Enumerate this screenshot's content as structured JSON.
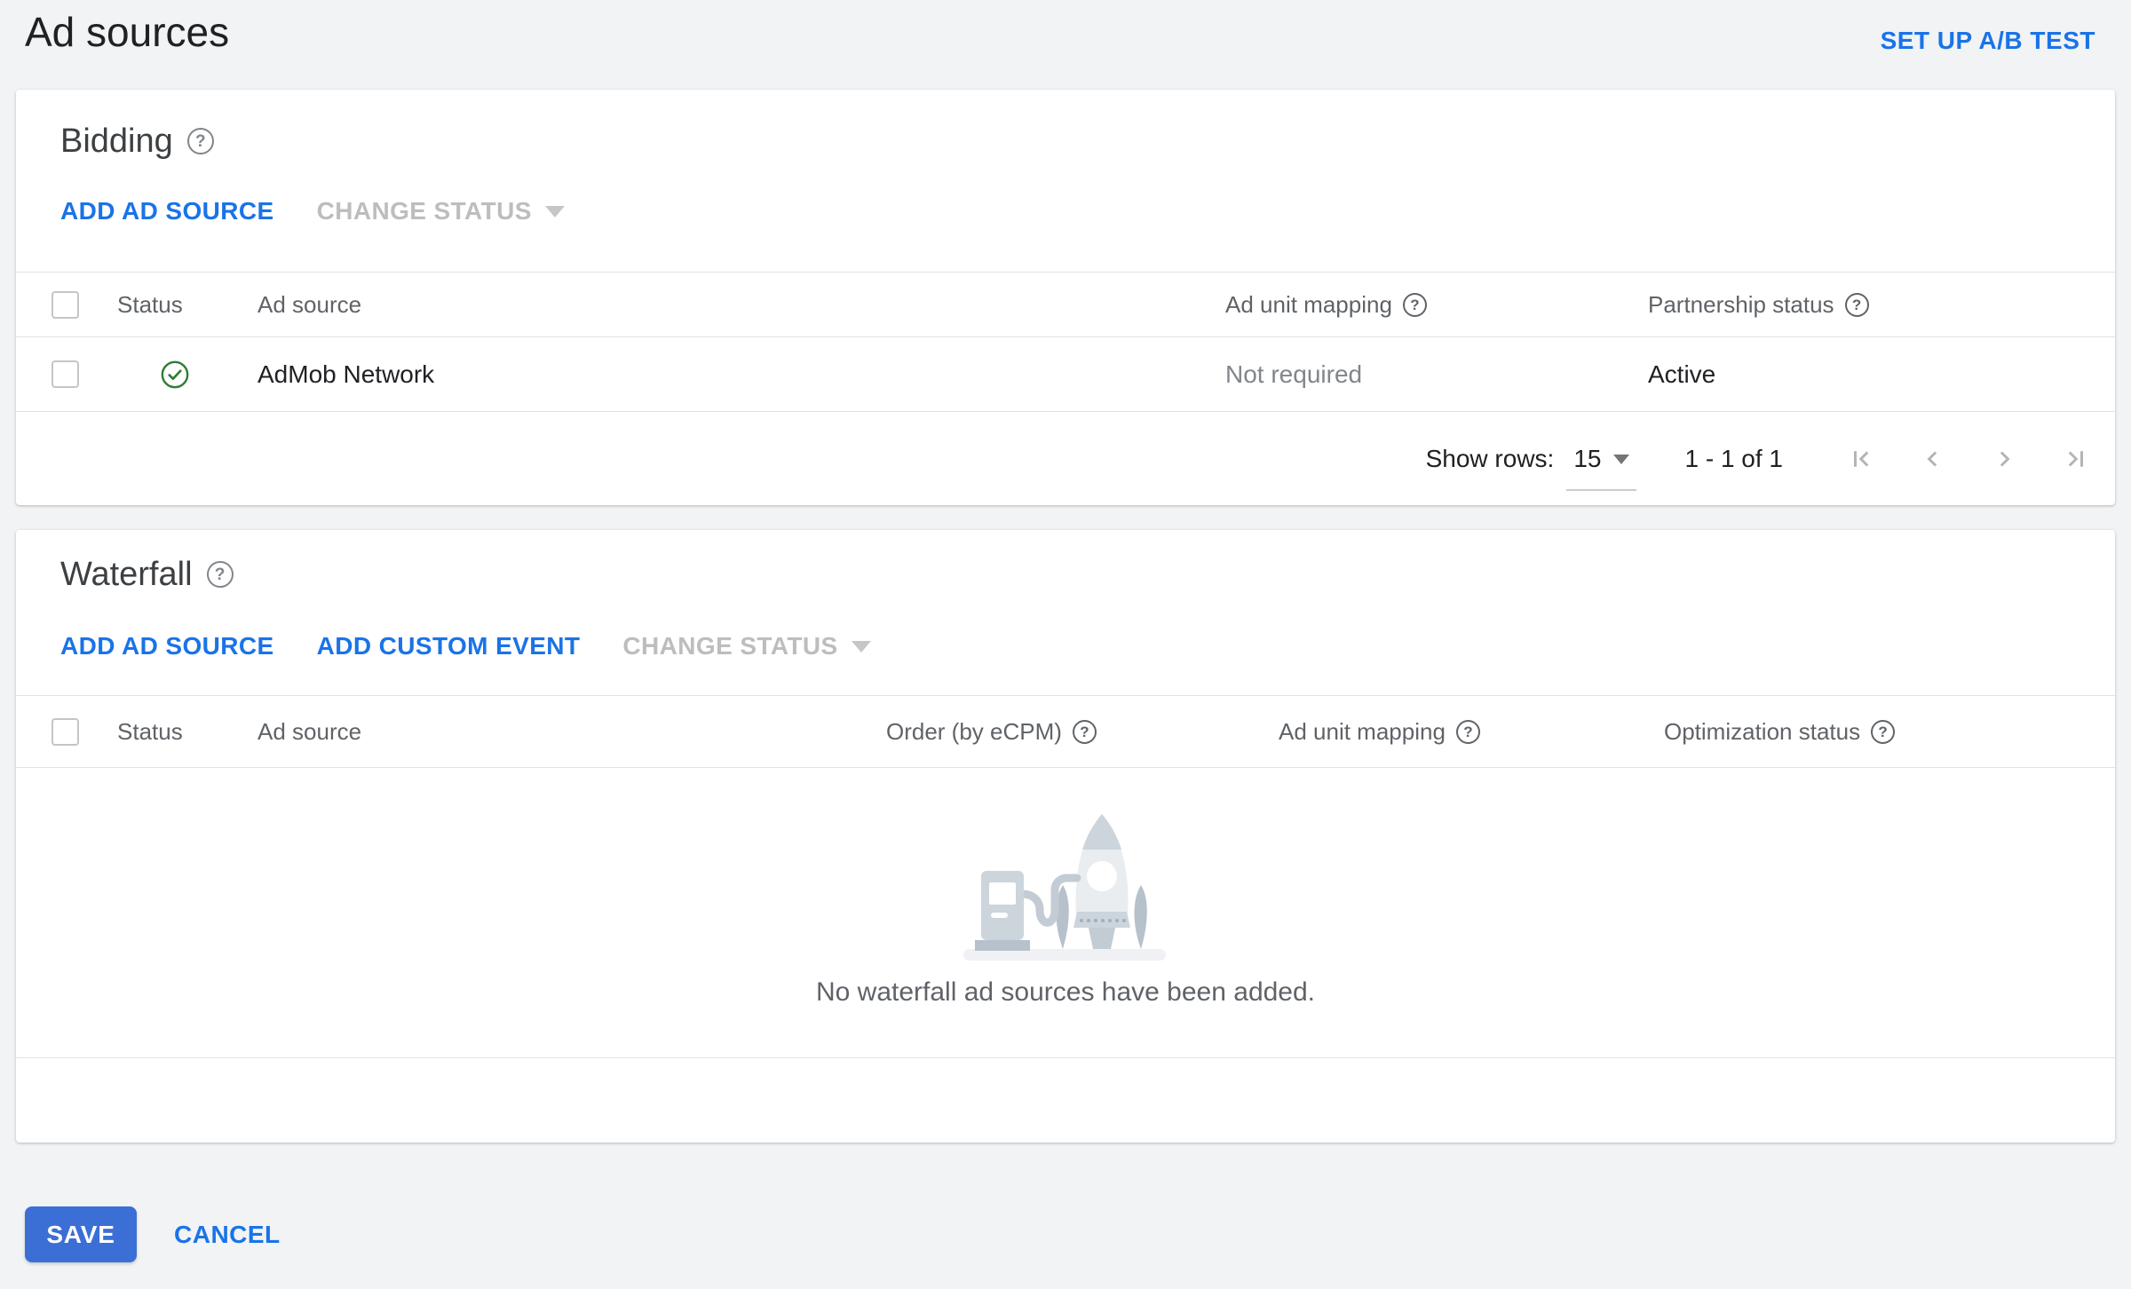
{
  "page": {
    "title": "Ad sources",
    "ab_test_link": "SET UP A/B TEST"
  },
  "bidding": {
    "title": "Bidding",
    "add_ad_source": "ADD AD SOURCE",
    "change_status": "CHANGE STATUS",
    "columns": {
      "status": "Status",
      "ad_source": "Ad source",
      "ad_unit_mapping": "Ad unit mapping",
      "partnership_status": "Partnership status"
    },
    "row": {
      "status_icon": "active-check",
      "ad_source": "AdMob Network",
      "ad_unit_mapping": "Not required",
      "partnership_status": "Active"
    },
    "pagination": {
      "label": "Show rows:",
      "value": "15",
      "range": "1 - 1 of 1"
    }
  },
  "waterfall": {
    "title": "Waterfall",
    "add_ad_source": "ADD AD SOURCE",
    "add_custom_event": "ADD CUSTOM EVENT",
    "change_status": "CHANGE STATUS",
    "columns": {
      "status": "Status",
      "ad_source": "Ad source",
      "order": "Order (by eCPM)",
      "ad_unit_mapping": "Ad unit mapping",
      "optimization_status": "Optimization status"
    },
    "empty_message": "No waterfall ad sources have been added."
  },
  "footer": {
    "save": "SAVE",
    "cancel": "CANCEL"
  },
  "help_glyph": "?",
  "colors": {
    "link_blue": "#1a73e8",
    "save_button_blue": "#3c6fd6",
    "active_green": "#2e7d32",
    "page_background": "#f1f3f4"
  }
}
